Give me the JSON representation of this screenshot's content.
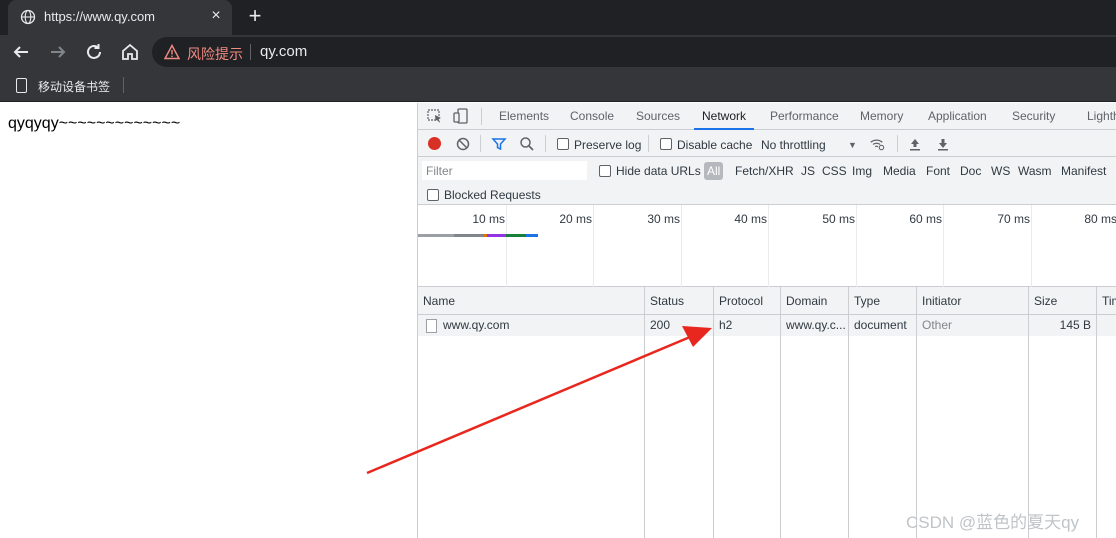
{
  "tab": {
    "title": "https://www.qy.com",
    "close": "×"
  },
  "new_tab": "+",
  "omnibox": {
    "warning": "风险提示",
    "url": "qy.com"
  },
  "bookmarks": {
    "item": "移动设备书签"
  },
  "page": {
    "text": "qyqyqy~~~~~~~~~~~~~"
  },
  "devtools": {
    "tabs": [
      "Elements",
      "Console",
      "Sources",
      "Network",
      "Performance",
      "Memory",
      "Application",
      "Security",
      "Lighth"
    ],
    "active_tab": "Network",
    "toolbar": {
      "preserve_log": "Preserve log",
      "disable_cache": "Disable cache",
      "throttling": "No throttling"
    },
    "filter": {
      "placeholder": "Filter",
      "hide_data_urls": "Hide data URLs",
      "types": [
        "All",
        "Fetch/XHR",
        "JS",
        "CSS",
        "Img",
        "Media",
        "Font",
        "Doc",
        "WS",
        "Wasm",
        "Manifest"
      ],
      "blocked_requests": "Blocked Requests"
    },
    "timeline": {
      "ticks": [
        "10 ms",
        "20 ms",
        "30 ms",
        "40 ms",
        "50 ms",
        "60 ms",
        "70 ms",
        "80 ms"
      ]
    },
    "table": {
      "columns": [
        "Name",
        "Status",
        "Protocol",
        "Domain",
        "Type",
        "Initiator",
        "Size",
        "Tim"
      ],
      "rows": [
        {
          "name": "www.qy.com",
          "status": "200",
          "protocol": "h2",
          "domain": "www.qy.c...",
          "type": "document",
          "initiator": "Other",
          "size": "145 B"
        }
      ]
    }
  },
  "watermark": "CSDN @蓝色的夏天qy",
  "colors": {
    "record": "#d93025",
    "accent": "#1a73e8",
    "arrow": "#e8281e",
    "warning": "#f28b82"
  }
}
